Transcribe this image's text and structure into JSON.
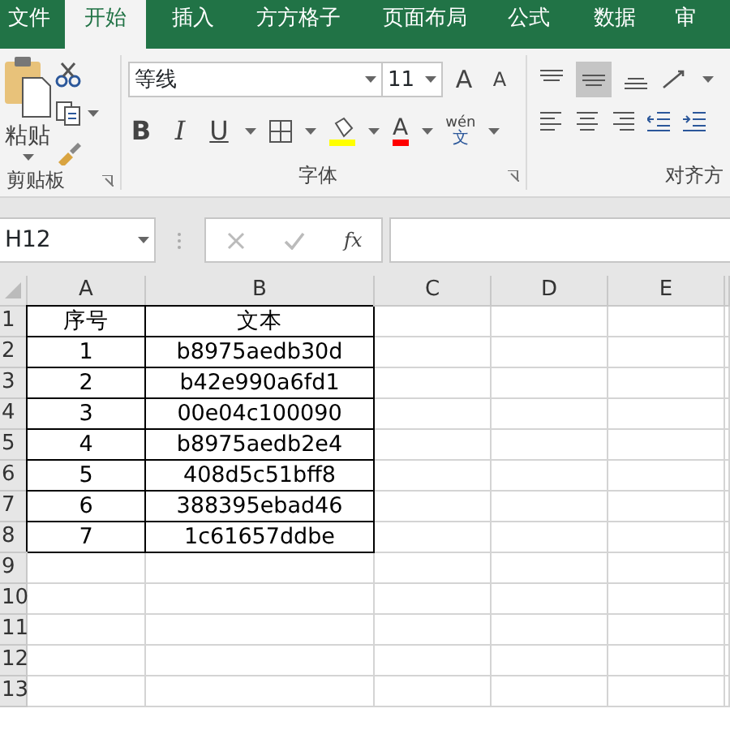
{
  "tabs": [
    {
      "label": "文件",
      "selected": false
    },
    {
      "label": "开始",
      "selected": true
    },
    {
      "label": "插入",
      "selected": false
    },
    {
      "label": "方方格子",
      "selected": false
    },
    {
      "label": "页面布局",
      "selected": false
    },
    {
      "label": "公式",
      "selected": false
    },
    {
      "label": "数据",
      "selected": false
    },
    {
      "label": "审",
      "selected": false
    }
  ],
  "clipboard": {
    "paste_label": "粘贴",
    "group_label": "剪贴板"
  },
  "font": {
    "font_name": "等线",
    "font_size": "11",
    "grow_label": "A",
    "shrink_label": "A",
    "bold_label": "B",
    "italic_label": "I",
    "underline_label": "U",
    "font_color_label": "A",
    "phonetic_top": "wén",
    "phonetic_bottom": "文",
    "group_label": "字体"
  },
  "alignment": {
    "group_label": "对齐方"
  },
  "formula_bar": {
    "name_box": "H12",
    "fx_label": "fx"
  },
  "sheet": {
    "columns": [
      "A",
      "B",
      "C",
      "D",
      "E"
    ],
    "rows": [
      {
        "number": "1",
        "cells": [
          "序号",
          "文本"
        ]
      },
      {
        "number": "2",
        "cells": [
          "1",
          "b8975aedb30d"
        ]
      },
      {
        "number": "3",
        "cells": [
          "2",
          "b42e990a6fd1"
        ]
      },
      {
        "number": "4",
        "cells": [
          "3",
          "00e04c100090"
        ]
      },
      {
        "number": "5",
        "cells": [
          "4",
          "b8975aedb2e4"
        ]
      },
      {
        "number": "6",
        "cells": [
          "5",
          "408d5c51bff8"
        ]
      },
      {
        "number": "7",
        "cells": [
          "6",
          "388395ebad46"
        ]
      },
      {
        "number": "8",
        "cells": [
          "7",
          "1c61657ddbe"
        ]
      },
      {
        "number": "9",
        "cells": []
      },
      {
        "number": "10",
        "cells": []
      },
      {
        "number": "11",
        "cells": []
      },
      {
        "number": "12",
        "cells": []
      },
      {
        "number": "13",
        "cells": []
      }
    ]
  }
}
